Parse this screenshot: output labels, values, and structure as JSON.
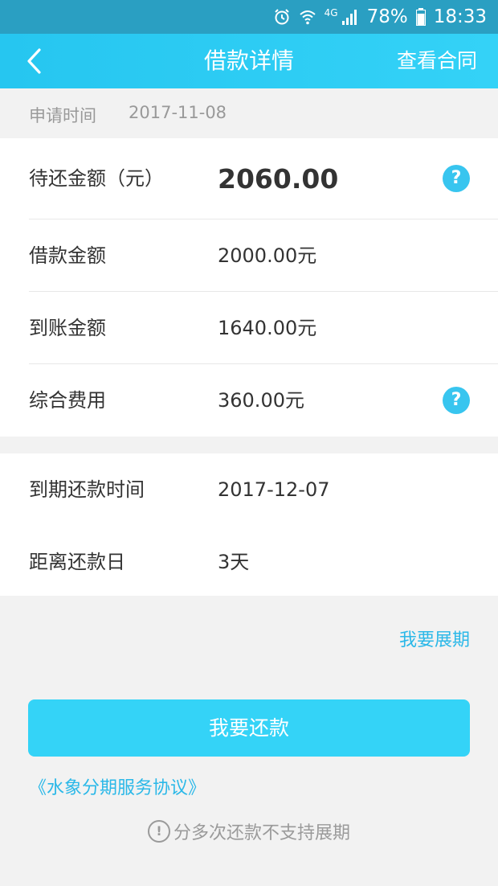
{
  "status_bar": {
    "signal_label": "4G",
    "battery": "78%",
    "time": "18:33",
    "icons": [
      "alarm-icon",
      "wifi-icon",
      "cell-signal-icon",
      "battery-icon"
    ]
  },
  "nav": {
    "back_icon": "chevron-left-icon",
    "title": "借款详情",
    "right_link": "查看合同"
  },
  "apply": {
    "label": "申请时间",
    "value": "2017-11-08"
  },
  "amounts": {
    "pending": {
      "label": "待还金额（元）",
      "value": "2060.00"
    },
    "loan": {
      "label": "借款金额",
      "value": "2000.00元"
    },
    "received": {
      "label": "到账金额",
      "value": "1640.00元"
    },
    "fee": {
      "label": "综合费用",
      "value": "360.00元"
    },
    "help_glyph": "?"
  },
  "schedule": {
    "due": {
      "label": "到期还款时间",
      "value": "2017-12-07"
    },
    "remaining": {
      "label": "距离还款日",
      "value": "3天"
    }
  },
  "actions": {
    "extend": "我要展期",
    "repay": "我要还款",
    "agreement": "《水象分期服务协议》",
    "notice_glyph": "!",
    "notice": "分多次还款不支持展期"
  },
  "colors": {
    "status_bar": "#2a9fc2",
    "nav_bar": "#26c6f0",
    "accent": "#34d3f7",
    "link": "#2bb8e8"
  }
}
